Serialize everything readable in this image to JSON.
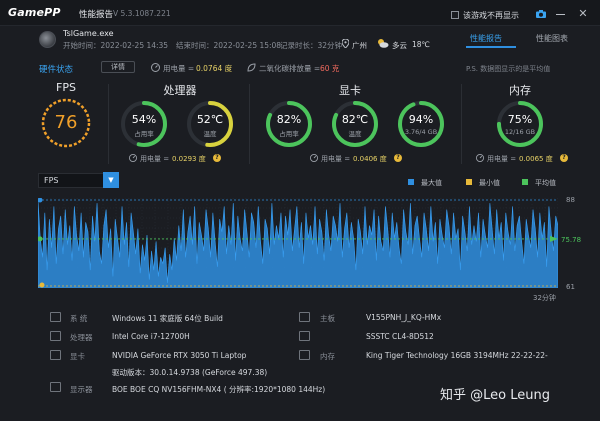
{
  "titlebar": {
    "logo": "GamePP",
    "title": "性能报告",
    "version": "V 5.3.1087.221",
    "noshow_label": "该游戏不再显示"
  },
  "session": {
    "game_name": "TslGame.exe",
    "start_time": "开始时间：2022-02-25 14:35",
    "end_time": "结束时间：2022-02-25 15:08",
    "record_time": "记录时长：32分钟",
    "location": "广州",
    "weather": "多云",
    "temperature": "18℃"
  },
  "tabs": {
    "report": "性能报告",
    "chart": "性能图表"
  },
  "hardware": {
    "title": "硬件状态",
    "details_button": "详情",
    "power_total_label": "用电量 =",
    "power_total_value": "0.0764 度",
    "co2_label": "二氧化碳排放量 =",
    "co2_value": "60 克",
    "ps_note": "P.S. 数据图显示的是平均值"
  },
  "fps": {
    "title": "FPS",
    "value": "76"
  },
  "cpu": {
    "title": "处理器",
    "usage_value": "54%",
    "usage_label": "占用率",
    "usage_pct": 54,
    "temp_value": "52℃",
    "temp_label": "温度",
    "temp_pct": 52,
    "power_label": "用电量 =",
    "power_value": "0.0293 度"
  },
  "gpu": {
    "title": "显卡",
    "usage_value": "82%",
    "usage_label": "占用率",
    "usage_pct": 82,
    "temp_value": "82℃",
    "temp_label": "温度",
    "temp_pct": 82,
    "vram_value": "94%",
    "vram_label": "3.76/4 GB",
    "vram_pct": 94,
    "power_label": "用电量 =",
    "power_value": "0.0406 度"
  },
  "memory": {
    "title": "内存",
    "usage_value": "75%",
    "usage_label": "12/16 GB",
    "usage_pct": 75,
    "power_label": "用电量 =",
    "power_value": "0.0065 度"
  },
  "chart_data": {
    "type": "area",
    "select_label": "FPS",
    "legend": [
      {
        "name": "最大值",
        "color": "#2f8fe0"
      },
      {
        "name": "最小值",
        "color": "#e7b93a"
      },
      {
        "name": "平均值",
        "color": "#4cc45c"
      }
    ],
    "ylim": [
      61,
      88
    ],
    "y_max_label": "88",
    "y_avg_label": "75.78",
    "y_min_label": "61",
    "x_end_label": "32分钟",
    "max": 88,
    "min": 61,
    "avg": 75.78,
    "values": [
      88,
      76,
      70,
      84,
      66,
      82,
      73,
      86,
      68,
      79,
      83,
      71,
      85,
      74,
      80,
      69,
      86,
      77,
      72,
      84,
      70,
      81,
      78,
      66,
      83,
      75,
      87,
      72,
      68,
      80,
      85,
      73,
      79,
      64,
      82,
      76,
      70,
      86,
      74,
      81,
      67,
      84,
      78,
      71,
      79,
      65,
      74,
      69,
      77,
      63,
      72,
      66,
      75,
      64,
      70,
      68,
      73,
      62,
      71,
      66,
      76,
      69,
      80,
      72,
      85,
      70,
      78,
      83,
      74,
      86,
      68,
      81,
      77,
      72,
      85,
      79,
      70,
      84,
      75,
      67,
      82,
      78,
      86,
      71,
      80,
      74,
      87,
      69,
      83,
      76,
      72,
      85,
      78,
      70,
      84,
      81,
      73,
      86,
      75,
      68,
      82,
      79,
      71,
      87,
      74,
      80,
      76,
      84,
      70,
      83,
      77,
      85,
      72,
      79,
      86,
      73,
      81,
      68,
      84,
      76,
      80,
      74,
      86,
      71,
      82,
      78,
      69,
      85,
      77,
      72,
      83,
      80,
      75,
      87,
      70,
      79,
      84,
      73,
      81,
      76,
      66,
      82,
      78,
      71,
      86,
      74,
      80,
      77,
      85,
      69,
      83,
      75,
      72,
      86,
      79,
      70,
      84,
      76,
      81,
      73,
      68,
      85,
      78,
      74,
      87,
      71,
      80,
      83,
      76,
      70,
      84,
      79,
      72,
      86,
      75,
      81,
      68,
      82,
      77,
      73,
      85,
      80,
      71,
      84,
      76,
      79,
      66,
      83,
      78,
      72,
      86,
      74,
      80,
      75,
      84,
      70,
      82,
      77,
      73,
      87,
      79,
      71,
      85,
      76,
      81,
      69,
      84,
      78,
      74,
      86,
      72,
      80,
      83,
      75,
      68,
      82,
      77,
      73,
      85,
      79,
      70,
      84,
      76,
      81,
      67,
      86,
      78,
      72,
      83,
      80
    ]
  },
  "system": {
    "os_label": "系  统",
    "os_value": "Windows 11 家庭版 64位   Build",
    "cpu_label": "处理器",
    "cpu_value": "Intel Core i7-12700H",
    "gpu_label": "显卡",
    "gpu_value": "NVIDIA GeForce RTX 3050 Ti Laptop",
    "driver_value": "驱动版本：30.0.14.9738 (GeForce 497.38)",
    "monitor_label": "显示器",
    "monitor_value": "BOE BOE CQ NV156FHM-NX4 ( 分辨率:1920*1080 144Hz)",
    "board_label": "主板",
    "board_value": "V155PNH_J_KQ-HMx",
    "storage_value": "SSSTC CL4-8D512",
    "mem_label": "内存",
    "mem_value": "King Tiger Technology 16GB 3194MHz 22-22-22-"
  },
  "watermark": "知乎 @Leo Leung"
}
